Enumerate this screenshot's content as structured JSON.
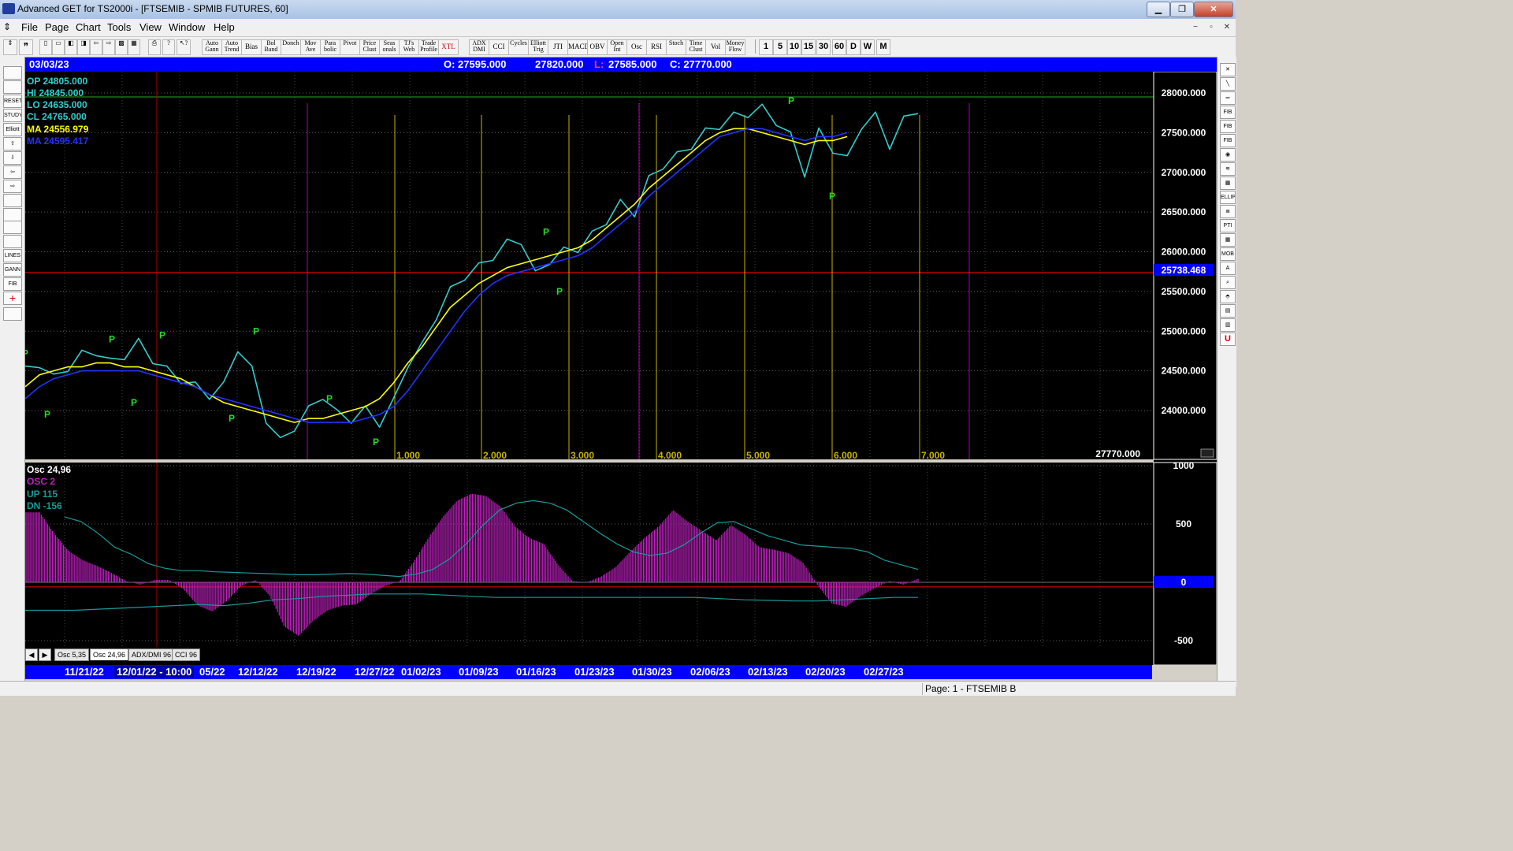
{
  "window": {
    "title": "Advanced GET for TS2000i - [FTSEMIB - SPMIB FUTURES, 60]",
    "minimize": "▁",
    "maximize": "❐",
    "close": "✕"
  },
  "menu": [
    "File",
    "Page",
    "Chart",
    "Tools",
    "View",
    "Window",
    "Help"
  ],
  "toolbar": {
    "studies": [
      "Auto Gann",
      "Auto Trend",
      "Bias",
      "Bol Band",
      "Donch",
      "Mov Ave",
      "Para bolic",
      "Pivot",
      "Price Clust",
      "Seas onals",
      "TJ's Web",
      "Trade Profile",
      "XTL",
      "ADX DMI",
      "CCI",
      "Cycles",
      "Elliott Trig",
      "JTI",
      "MACD",
      "OBV",
      "Open Int",
      "Osc",
      "RSI",
      "Stoch",
      "Time Clust",
      "Vol",
      "Money Flow"
    ],
    "intervals": [
      "1",
      "5",
      "10",
      "15",
      "30",
      "60",
      "D",
      "W",
      "M"
    ]
  },
  "left_tools": [
    "",
    "",
    "RESET",
    "STUDY",
    "Elliott",
    "⇧",
    "⇩",
    "⇦",
    "⇨",
    "",
    "",
    "",
    "",
    "LINES",
    "GANN",
    "FIB",
    "+",
    ""
  ],
  "right_tools": [
    "✕",
    "╲",
    "═",
    "FIB RET",
    "FIB EXT",
    "FIB TIME",
    "◉",
    "≋",
    "▦",
    "ELLIPS",
    "≣",
    "PTI",
    "▦",
    "MOB",
    "A",
    "⌕",
    "⬘",
    "▤",
    "▥",
    "U"
  ],
  "infobar": {
    "date": "03/03/23",
    "open": "O: 27595.000",
    "high": "27820.000",
    "low_label": "L:",
    "low": "27585.000",
    "close": "C: 27770.000"
  },
  "readout": {
    "op": "OP  24805.000",
    "hi": "HI   24845.000",
    "lo": "LO  24635.000",
    "cl": "CL  24765.000",
    "ma1": "MA  24556.979",
    "ma2": "MA  24595.417"
  },
  "osc_readout": {
    "title": "Osc 24,96",
    "osc2": "OSC 2",
    "up": "UP   115",
    "dn": "DN   -156"
  },
  "colors": {
    "price": "#33cccc",
    "ma_fast": "#ffff00",
    "ma_slow": "#2233ff",
    "osc": "#c020c0",
    "pivot": "#22dd22",
    "cycle_line": "#c8b400",
    "magenta_line": "#b000b0",
    "red_line": "#ff0000"
  },
  "last_price_box": "25738.468",
  "last_close_label": "27770.000",
  "osc_zero_box": "0",
  "cycle_labels": [
    "1.000",
    "2.000",
    "3.000",
    "4.000",
    "5.000",
    "6.000",
    "7.000"
  ],
  "pivot_label": "P",
  "tabs": [
    "Osc 5,35",
    "Osc 24,96",
    "ADX/DMI 96",
    "CCI 96"
  ],
  "dates": [
    "11/21/22",
    "12/01/22 - 10:00",
    "05/22",
    "12/12/22",
    "12/19/22",
    "12/27/22",
    "01/02/23",
    "01/09/23",
    "01/16/23",
    "01/23/23",
    "01/30/23",
    "02/06/23",
    "02/13/23",
    "02/20/23",
    "02/27/23"
  ],
  "status": "Page: 1 - FTSEMIB B",
  "chart_data": [
    {
      "type": "line",
      "title": "FTSEMIB - SPMIB FUTURES, 60",
      "y_ticks": [
        28000,
        27500,
        27000,
        26500,
        26000,
        25500,
        25000,
        24500,
        24000
      ],
      "ylim": [
        23500,
        28250
      ],
      "x_tick_labels": [
        "11/21/22",
        "12/01/22",
        "12/12/22",
        "12/19/22",
        "12/27/22",
        "01/02/23",
        "01/09/23",
        "01/16/23",
        "01/23/23",
        "01/30/23",
        "02/06/23",
        "02/13/23",
        "02/20/23",
        "02/27/23"
      ],
      "series": [
        {
          "name": "price",
          "values": [
            24500,
            24600,
            24400,
            24550,
            24700,
            24750,
            24600,
            24700,
            24850,
            24650,
            24500,
            24400,
            24300,
            24200,
            24300,
            24800,
            24500,
            23900,
            23600,
            23800,
            24000,
            24200,
            23950,
            23900,
            24000,
            23850,
            24100,
            24600,
            24800,
            25200,
            25500,
            25700,
            25800,
            25950,
            26100,
            26150,
            25700,
            25900,
            26000,
            26050,
            26200,
            26400,
            26600,
            26500,
            26900,
            27100,
            27200,
            27350,
            27500,
            27600,
            27700,
            27750,
            27800,
            27650,
            27450,
            27000,
            27500,
            27300,
            27150,
            27600,
            27700,
            27350,
            27650,
            27800
          ]
        },
        {
          "name": "MA",
          "values": [
            24300,
            24450,
            24500,
            24550,
            24550,
            24600,
            24600,
            24550,
            24550,
            24500,
            24450,
            24400,
            24300,
            24200,
            24100,
            24050,
            24000,
            23950,
            23900,
            23850,
            23900,
            23900,
            23950,
            24000,
            24050,
            24150,
            24350,
            24600,
            24800,
            25050,
            25300,
            25450,
            25600,
            25700,
            25800,
            25850,
            25900,
            25950,
            26000,
            26050,
            26150,
            26300,
            26450,
            26600,
            26800,
            26950,
            27100,
            27250,
            27400,
            27500,
            27550,
            27550,
            27500,
            27450,
            27400,
            27350,
            27400,
            27400,
            27450
          ]
        },
        {
          "name": "MA",
          "values": [
            24150,
            24300,
            24400,
            24450,
            24500,
            24500,
            24500,
            24500,
            24500,
            24450,
            24400,
            24350,
            24300,
            24200,
            24150,
            24100,
            24050,
            24000,
            23950,
            23900,
            23850,
            23850,
            23850,
            23850,
            23900,
            23950,
            24050,
            24250,
            24500,
            24750,
            25000,
            25250,
            25450,
            25600,
            25700,
            25750,
            25800,
            25850,
            25900,
            25950,
            26050,
            26200,
            26350,
            26500,
            26700,
            26850,
            27000,
            27150,
            27300,
            27450,
            27500,
            27550,
            27550,
            27500,
            27450,
            27400,
            27450,
            27450,
            27500
          ]
        }
      ],
      "pivots_high": [
        24800,
        24850,
        24900,
        24850,
        24750,
        26150,
        27800
      ],
      "pivots_low": [
        24050,
        24200,
        24000,
        23700,
        25600,
        26800
      ]
    },
    {
      "type": "bar",
      "title": "Osc 24,96",
      "y_ticks": [
        1000,
        500,
        0,
        -500
      ],
      "ylim": [
        -650,
        1000
      ],
      "series": [
        {
          "name": "OSC 2",
          "values": [
            600,
            600,
            420,
            270,
            190,
            140,
            80,
            10,
            -20,
            20,
            20,
            -60,
            -200,
            -250,
            -160,
            -30,
            20,
            -120,
            -380,
            -460,
            -330,
            -240,
            -200,
            -190,
            -100,
            -30,
            10,
            180,
            380,
            560,
            700,
            760,
            740,
            650,
            480,
            380,
            330,
            150,
            10,
            0,
            50,
            130,
            260,
            380,
            480,
            620,
            520,
            440,
            360,
            490,
            410,
            300,
            280,
            250,
            170,
            -20,
            -180,
            -210,
            -120,
            -50,
            10,
            -20,
            30
          ]
        },
        {
          "name": "UP",
          "values": [
            560,
            520,
            420,
            300,
            240,
            160,
            120,
            100,
            100,
            90,
            85,
            80,
            75,
            70,
            65,
            65,
            70,
            75,
            70,
            60,
            50,
            70,
            110,
            200,
            330,
            490,
            620,
            680,
            700,
            680,
            620,
            520,
            420,
            330,
            260,
            230,
            250,
            320,
            420,
            510,
            520,
            460,
            400,
            360,
            320,
            310,
            300,
            290,
            260,
            190,
            150,
            110
          ]
        },
        {
          "name": "DN",
          "values": [
            -240,
            -240,
            -240,
            -230,
            -220,
            -210,
            -200,
            -190,
            -200,
            -180,
            -150,
            -140,
            -120,
            -110,
            -100,
            -100,
            -100,
            -110,
            -120,
            -130,
            -130,
            -130,
            -130,
            -130,
            -130,
            -130,
            -130,
            -130,
            -140,
            -150,
            -155,
            -160,
            -160,
            -150,
            -140,
            -130,
            -130
          ]
        }
      ]
    }
  ]
}
